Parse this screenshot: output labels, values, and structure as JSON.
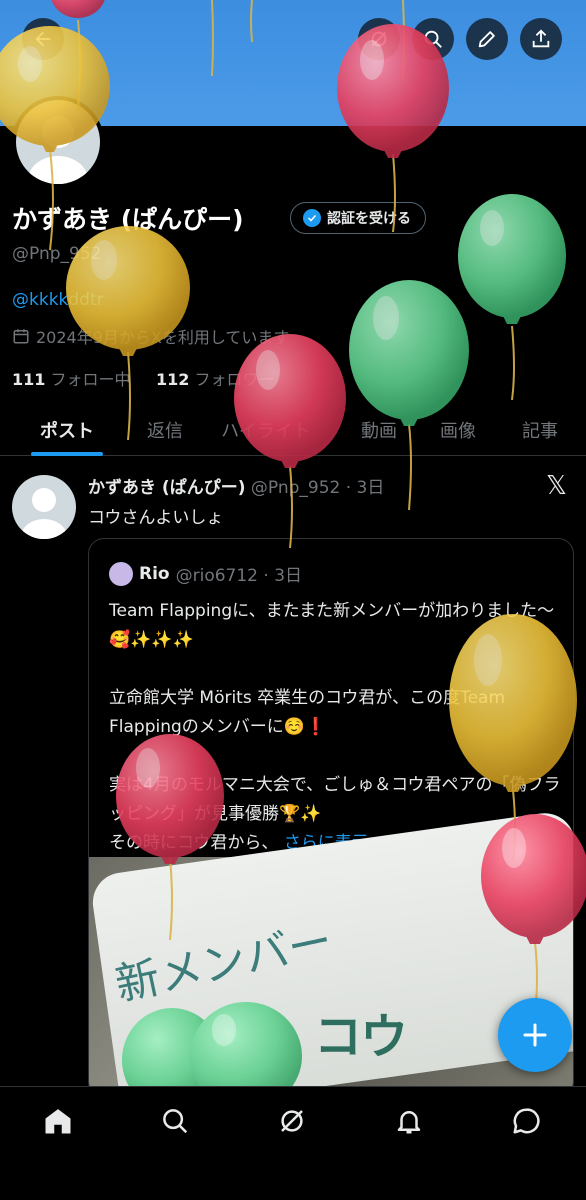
{
  "profile": {
    "name": "かずあき (ぱんぴー)",
    "verify_label": "認証を受ける",
    "handle": "@Pnp_952",
    "bio_link": "@kkkkddtr",
    "joined": "2024年9月からXを利用しています",
    "following_count": "111",
    "following_label": "フォロー中",
    "followers_count": "112",
    "followers_label": "フォロワー"
  },
  "tabs": [
    {
      "label": "ポスト",
      "active": true
    },
    {
      "label": "返信"
    },
    {
      "label": "ハイライト"
    },
    {
      "label": "動画"
    },
    {
      "label": "画像"
    },
    {
      "label": "記事"
    }
  ],
  "post": {
    "author": "かずあき (ぱんぴー)",
    "handle_time": "@Pnp_952 · 3日",
    "text": "コウさんよいしょ",
    "quote": {
      "author": "Rio",
      "handle_time": "@rio6712 · 3日",
      "lines": [
        "Team Flappingに、またまた新メンバーが加わりました〜🥰✨✨✨",
        "",
        "立命館大学 Mörits 卒業生のコウ君が、この度Team Flappingのメンバーに☺️❗️",
        "",
        "実は4月のモルマニ大会で、ごしゅ＆コウ君ペアの「偽フラッピング」が見事優勝🏆✨",
        "その時にコウ君から、"
      ],
      "more": "さらに表示",
      "image_text_1": "新メンバー",
      "image_text_2": "コウ"
    }
  },
  "colors": {
    "accent": "#1d9bf0",
    "background": "#000000",
    "banner": "#4b9be8",
    "balloon_red": "#e8405f",
    "balloon_yellow": "#f0c43a",
    "balloon_green": "#5fd08e"
  },
  "icons": {
    "header": [
      "back-arrow-icon",
      "grok-icon",
      "search-icon",
      "edit-icon",
      "share-icon"
    ],
    "bottom_nav": [
      "home-icon",
      "search-icon",
      "grok-icon",
      "bell-icon",
      "messages-icon"
    ],
    "fab": "plus-icon"
  }
}
